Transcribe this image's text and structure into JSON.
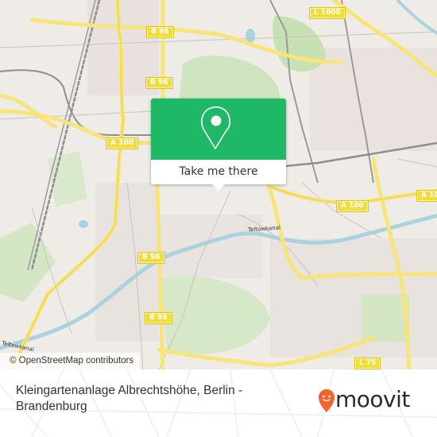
{
  "map": {
    "road_shields": [
      {
        "id": "b96-top",
        "label": "B 96"
      },
      {
        "id": "b96-mid",
        "label": "B 96"
      },
      {
        "id": "l1000",
        "label": "L 1000"
      },
      {
        "id": "a100-left",
        "label": "A 100"
      },
      {
        "id": "a100-right",
        "label": "A 100"
      },
      {
        "id": "a10-edge",
        "label": "A 10"
      },
      {
        "id": "b96-lower",
        "label": "B 96"
      },
      {
        "id": "b96-bottom",
        "label": "B 96"
      },
      {
        "id": "l75",
        "label": "L 75"
      }
    ],
    "water_labels": [
      {
        "id": "teltowkanal-east",
        "label": "Teltowkanal"
      },
      {
        "id": "teltowkanal-west",
        "label": "Teltowkanal"
      }
    ],
    "attribution": "© OpenStreetMap contributors"
  },
  "popup": {
    "icon": "map-pin-icon",
    "button_label": "Take me there",
    "accent_color": "#1fb866"
  },
  "footer": {
    "place_name": "Kleingartenanlage Albrechtshöhe, Berlin - Brandenburg",
    "brand": {
      "name": "moovit",
      "icon": "moovit-pin-icon",
      "color": "#f26531"
    }
  }
}
